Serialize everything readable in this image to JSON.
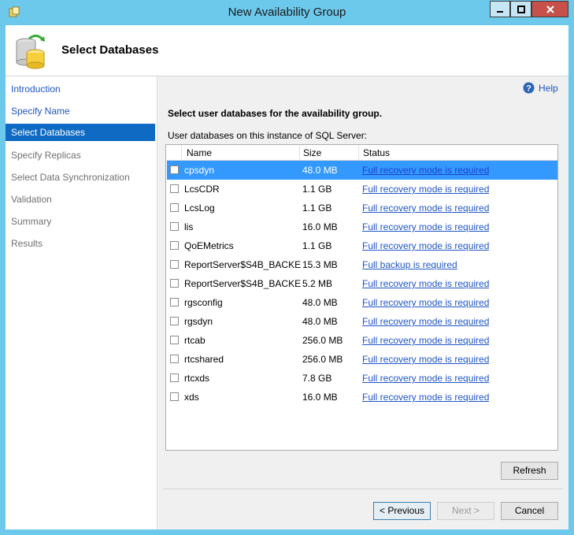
{
  "window": {
    "title": "New Availability Group"
  },
  "header": {
    "title": "Select Databases"
  },
  "nav": {
    "items": [
      {
        "label": "Introduction",
        "state": "link"
      },
      {
        "label": "Specify Name",
        "state": "link"
      },
      {
        "label": "Select Databases",
        "state": "selected"
      },
      {
        "label": "Specify Replicas",
        "state": "disabled"
      },
      {
        "label": "Select Data Synchronization",
        "state": "disabled"
      },
      {
        "label": "Validation",
        "state": "disabled"
      },
      {
        "label": "Summary",
        "state": "disabled"
      },
      {
        "label": "Results",
        "state": "disabled"
      }
    ]
  },
  "help_label": "Help",
  "instruction": "Select user databases for the availability group.",
  "grid_label": "User databases on this instance of SQL Server:",
  "grid": {
    "columns": [
      "Name",
      "Size",
      "Status"
    ],
    "rows": [
      {
        "name": "cpsdyn",
        "size": "48.0 MB",
        "status": "Full recovery mode is required",
        "selected": true,
        "checked": false
      },
      {
        "name": "LcsCDR",
        "size": "1.1 GB",
        "status": "Full recovery mode is required",
        "checked": false
      },
      {
        "name": "LcsLog",
        "size": "1.1 GB",
        "status": "Full recovery mode is required",
        "checked": false
      },
      {
        "name": "lis",
        "size": "16.0 MB",
        "status": "Full recovery mode is required",
        "checked": false
      },
      {
        "name": "QoEMetrics",
        "size": "1.1 GB",
        "status": "Full recovery mode is required",
        "checked": false
      },
      {
        "name": "ReportServer$S4B_BACKE...",
        "size": "15.3 MB",
        "status": "Full backup is required",
        "checked": false
      },
      {
        "name": "ReportServer$S4B_BACKE...",
        "size": "5.2 MB",
        "status": "Full recovery mode is required",
        "checked": false
      },
      {
        "name": "rgsconfig",
        "size": "48.0 MB",
        "status": "Full recovery mode is required",
        "checked": false
      },
      {
        "name": "rgsdyn",
        "size": "48.0 MB",
        "status": "Full recovery mode is required",
        "checked": false
      },
      {
        "name": "rtcab",
        "size": "256.0 MB",
        "status": "Full recovery mode is required",
        "checked": false
      },
      {
        "name": "rtcshared",
        "size": "256.0 MB",
        "status": "Full recovery mode is required",
        "checked": false
      },
      {
        "name": "rtcxds",
        "size": "7.8 GB",
        "status": "Full recovery mode is required",
        "checked": false
      },
      {
        "name": "xds",
        "size": "16.0 MB",
        "status": "Full recovery mode is required",
        "checked": false
      }
    ]
  },
  "buttons": {
    "refresh": "Refresh",
    "previous": "< Previous",
    "next": "Next >",
    "cancel": "Cancel"
  },
  "colors": {
    "title_bar": "#6cc9ec",
    "nav_selected": "#0e6ac2",
    "row_selected": "#3399ff",
    "link": "#1f56c4"
  }
}
